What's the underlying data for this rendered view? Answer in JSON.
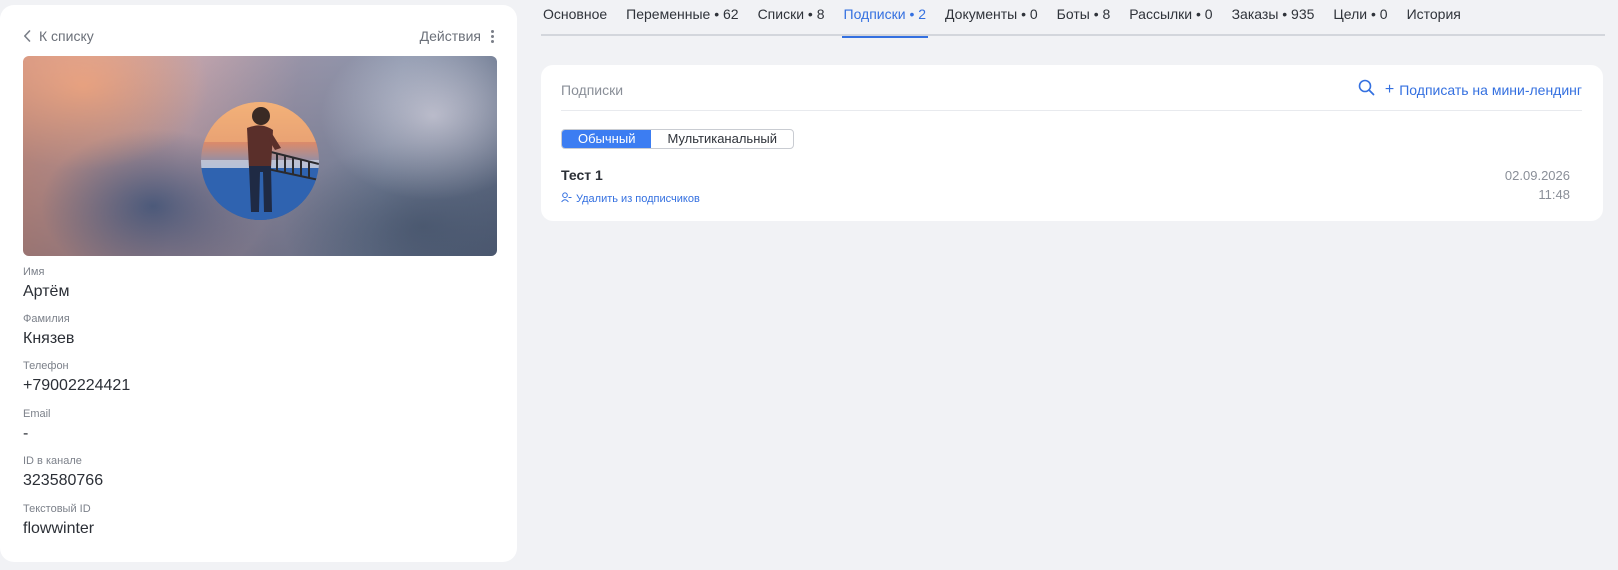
{
  "profile": {
    "back_label": "К списку",
    "actions_label": "Действия",
    "fields": [
      {
        "label": "Имя",
        "value": "Артём"
      },
      {
        "label": "Фамилия",
        "value": "Князев"
      },
      {
        "label": "Телефон",
        "value": "+79002224421"
      },
      {
        "label": "Email",
        "value": "-"
      },
      {
        "label": "ID в канале",
        "value": "323580766"
      },
      {
        "label": "Текстовый ID",
        "value": "flowwinter"
      }
    ]
  },
  "tabs": [
    {
      "label": "Основное",
      "active": false
    },
    {
      "label": "Переменные • 62",
      "active": false
    },
    {
      "label": "Списки • 8",
      "active": false
    },
    {
      "label": "Подписки • 2",
      "active": true
    },
    {
      "label": "Документы • 0",
      "active": false
    },
    {
      "label": "Боты • 8",
      "active": false
    },
    {
      "label": "Рассылки • 0",
      "active": false
    },
    {
      "label": "Заказы • 935",
      "active": false
    },
    {
      "label": "Цели • 0",
      "active": false
    },
    {
      "label": "История",
      "active": false
    }
  ],
  "subscriptions": {
    "title": "Подписки",
    "add_plus": "+",
    "add_label": "Подписать на мини-лендинг",
    "segments": [
      "Обычный",
      "Мультиканальный"
    ],
    "items": [
      {
        "name": "Тест 1",
        "action_label": "Удалить из подписчиков",
        "date": "02.09.2026",
        "time": "11:48"
      }
    ]
  },
  "colors": {
    "accent": "#3470e0",
    "segment_active": "#3c7df2",
    "page_background": "#f1f2f5"
  },
  "icons": [
    "chevron-left-icon",
    "kebab-menu-icon",
    "search-icon",
    "user-minus-icon"
  ]
}
